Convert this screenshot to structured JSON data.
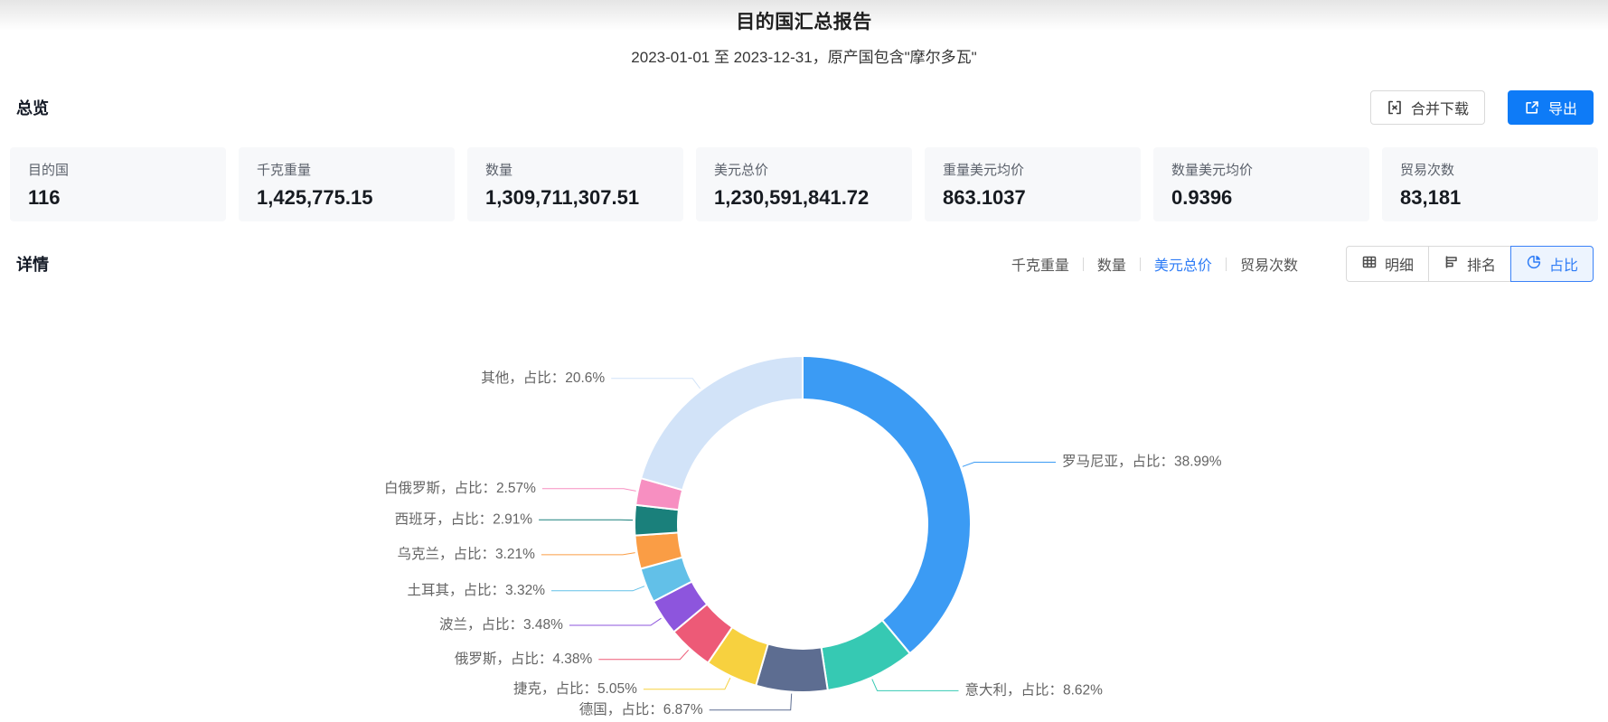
{
  "header": {
    "title": "目的国汇总报告",
    "subtitle": "2023-01-01 至 2023-12-31，原产国包含\"摩尔多瓦\""
  },
  "overview": {
    "heading": "总览",
    "buttons": {
      "merge_download": "合并下载",
      "export": "导出"
    },
    "cards": [
      {
        "label": "目的国",
        "value": "116"
      },
      {
        "label": "千克重量",
        "value": "1,425,775.15"
      },
      {
        "label": "数量",
        "value": "1,309,711,307.51"
      },
      {
        "label": "美元总价",
        "value": "1,230,591,841.72"
      },
      {
        "label": "重量美元均价",
        "value": "863.1037"
      },
      {
        "label": "数量美元均价",
        "value": "0.9396"
      },
      {
        "label": "贸易次数",
        "value": "83,181"
      }
    ]
  },
  "details": {
    "heading": "详情",
    "metric_tabs": [
      {
        "label": "千克重量",
        "active": false
      },
      {
        "label": "数量",
        "active": false
      },
      {
        "label": "美元总价",
        "active": true
      },
      {
        "label": "贸易次数",
        "active": false
      }
    ],
    "view_buttons": [
      {
        "label": "明细",
        "icon": "table-icon",
        "active": false
      },
      {
        "label": "排名",
        "icon": "ranking-icon",
        "active": false
      },
      {
        "label": "占比",
        "icon": "pie-icon",
        "active": true
      }
    ]
  },
  "chart_data": {
    "type": "pie",
    "donut": true,
    "start_angle": "top",
    "direction": "clockwise",
    "label_template": "{name}，占比：{pct}%",
    "series": [
      {
        "name": "罗马尼亚",
        "pct": 38.99,
        "color": "#3b9bf4"
      },
      {
        "name": "意大利",
        "pct": 8.62,
        "color": "#36c9b3"
      },
      {
        "name": "德国",
        "pct": 6.87,
        "color": "#5d6d91"
      },
      {
        "name": "捷克",
        "pct": 5.05,
        "color": "#f7d13f"
      },
      {
        "name": "俄罗斯",
        "pct": 4.38,
        "color": "#ed5a77"
      },
      {
        "name": "波兰",
        "pct": 3.48,
        "color": "#8d55dd"
      },
      {
        "name": "土耳其",
        "pct": 3.32,
        "color": "#62c0e8"
      },
      {
        "name": "乌克兰",
        "pct": 3.21,
        "color": "#fa9d45"
      },
      {
        "name": "西班牙",
        "pct": 2.91,
        "color": "#1a807b"
      },
      {
        "name": "白俄罗斯",
        "pct": 2.57,
        "color": "#f78fc1"
      },
      {
        "name": "其他",
        "pct": 20.6,
        "color": "#d2e3f8"
      }
    ]
  },
  "colors": {
    "accent_blue": "#2e7cf6",
    "primary_button": "#0e7bf7",
    "card_bg": "#f7f8fa",
    "label_gray": "#646464"
  }
}
